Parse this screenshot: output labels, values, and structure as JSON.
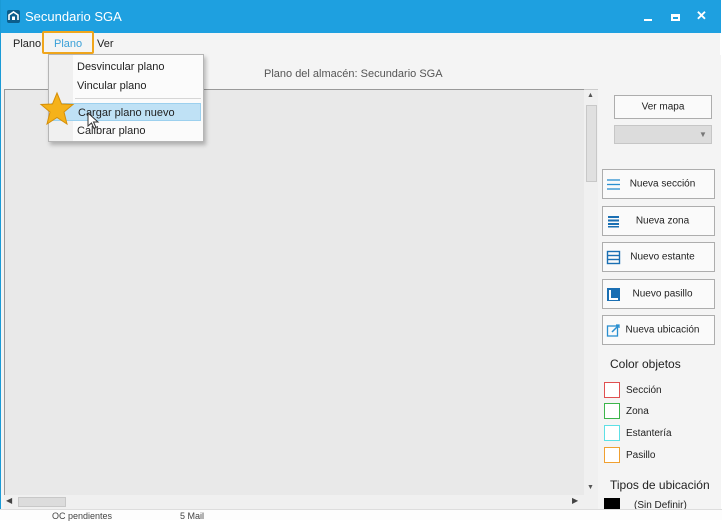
{
  "window": {
    "title": "Secundario SGA",
    "titlebar_color": "#1ea0e0",
    "controls": [
      "minimize-icon",
      "maximize-icon",
      "close-icon"
    ]
  },
  "menubar": {
    "items": [
      {
        "label": "Plano"
      },
      {
        "label": "Plano"
      },
      {
        "label": "Ver"
      }
    ],
    "highlight_color": "#f0a61c"
  },
  "dropdown": {
    "items": [
      {
        "label": "Desvincular plano"
      },
      {
        "label": "Vincular plano"
      },
      {
        "label": "Cargar plano nuevo"
      },
      {
        "label": "Calibrar plano"
      }
    ],
    "selected_index": 2,
    "selected_color": "#bfe1f5"
  },
  "canvas": {
    "title": "Plano del almacén: Secundario SGA"
  },
  "side": {
    "ver_mapa": "Ver mapa",
    "buttons": [
      {
        "label": "Nueva sección",
        "icon": "section-lines-icon"
      },
      {
        "label": "Nueva zona",
        "icon": "zone-lines-icon"
      },
      {
        "label": "Nuevo estante",
        "icon": "shelf-icon"
      },
      {
        "label": "Nuevo pasillo",
        "icon": "aisle-icon"
      },
      {
        "label": "Nueva ubicación",
        "icon": "location-edit-icon"
      }
    ],
    "color_title": "Color objetos",
    "legend": [
      {
        "label": "Sección",
        "color": "#e05050"
      },
      {
        "label": "Zona",
        "color": "#3cb54a"
      },
      {
        "label": "Estantería",
        "color": "#5de0e6"
      },
      {
        "label": "Pasillo",
        "color": "#f0a030"
      }
    ],
    "tipos_title": "Tipos de ubicación",
    "tipos": [
      {
        "label": "(Sin Definir)",
        "color": "#000000"
      }
    ]
  },
  "bottom_strip": {
    "left": "OC pendientes",
    "right": "5 Mail"
  }
}
